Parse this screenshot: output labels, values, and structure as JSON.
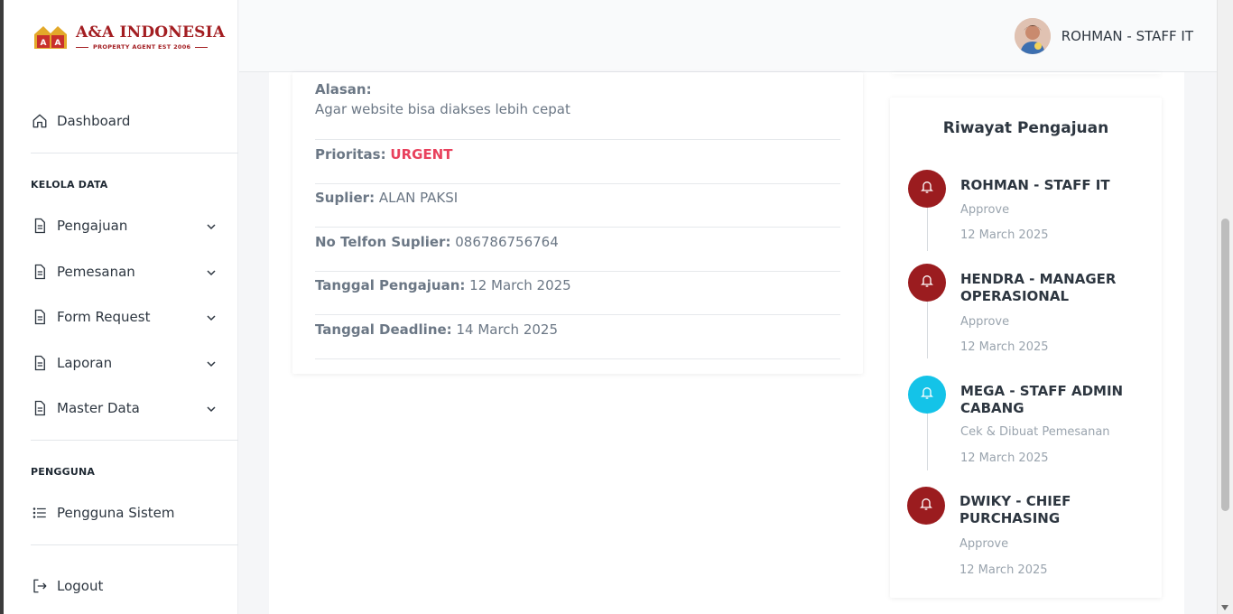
{
  "brand": {
    "title": "A&A INDONESIA",
    "subtitle": "PROPERTY AGENT EST 2006",
    "mark_text": "A&A",
    "color": "#a31e22"
  },
  "user": {
    "name": "ROHMAN - STAFF IT"
  },
  "sidebar": {
    "dashboard": {
      "label": "Dashboard",
      "icon": "home-icon"
    },
    "section_manage": "KELOLA DATA",
    "manage_items": [
      {
        "label": "Pengajuan",
        "icon": "document-icon"
      },
      {
        "label": "Pemesanan",
        "icon": "document-icon"
      },
      {
        "label": "Form Request",
        "icon": "document-icon"
      },
      {
        "label": "Laporan",
        "icon": "document-icon"
      },
      {
        "label": "Master Data",
        "icon": "document-icon"
      }
    ],
    "section_users": "PENGGUNA",
    "users_item": {
      "label": "Pengguna Sistem",
      "icon": "list-icon"
    },
    "logout": {
      "label": "Logout",
      "icon": "logout-icon"
    }
  },
  "details": {
    "reason_label": "Alasan:",
    "reason_value": "Agar website bisa diakses lebih cepat",
    "priority_label": "Prioritas:",
    "priority_value": "URGENT",
    "supplier_label": "Suplier:",
    "supplier_value": "ALAN PAKSI",
    "phone_label": "No Telfon Suplier:",
    "phone_value": "086786756764",
    "submitted_label": "Tanggal Pengajuan:",
    "submitted_value": "12 March 2025",
    "deadline_label": "Tanggal Deadline:",
    "deadline_value": "14 March 2025"
  },
  "history": {
    "title": "Riwayat Pengajuan",
    "items": [
      {
        "name": "ROHMAN - STAFF IT",
        "status": "Approve",
        "date": "12 March 2025",
        "color": "#9b1c1f"
      },
      {
        "name": "HENDRA - MANAGER OPERASIONAL",
        "status": "Approve",
        "date": "12 March 2025",
        "color": "#9b1c1f"
      },
      {
        "name": "MEGA - STAFF ADMIN CABANG",
        "status": "Cek & Dibuat Pemesanan",
        "date": "12 March 2025",
        "color": "#14c3e8"
      },
      {
        "name": "DWIKY - CHIEF PURCHASING",
        "status": "Approve",
        "date": "12 March 2025",
        "color": "#9b1c1f"
      }
    ]
  },
  "colors": {
    "urgent": "#e8415d",
    "approve_dot": "#9b1c1f",
    "pending_dot": "#14c3e8"
  }
}
